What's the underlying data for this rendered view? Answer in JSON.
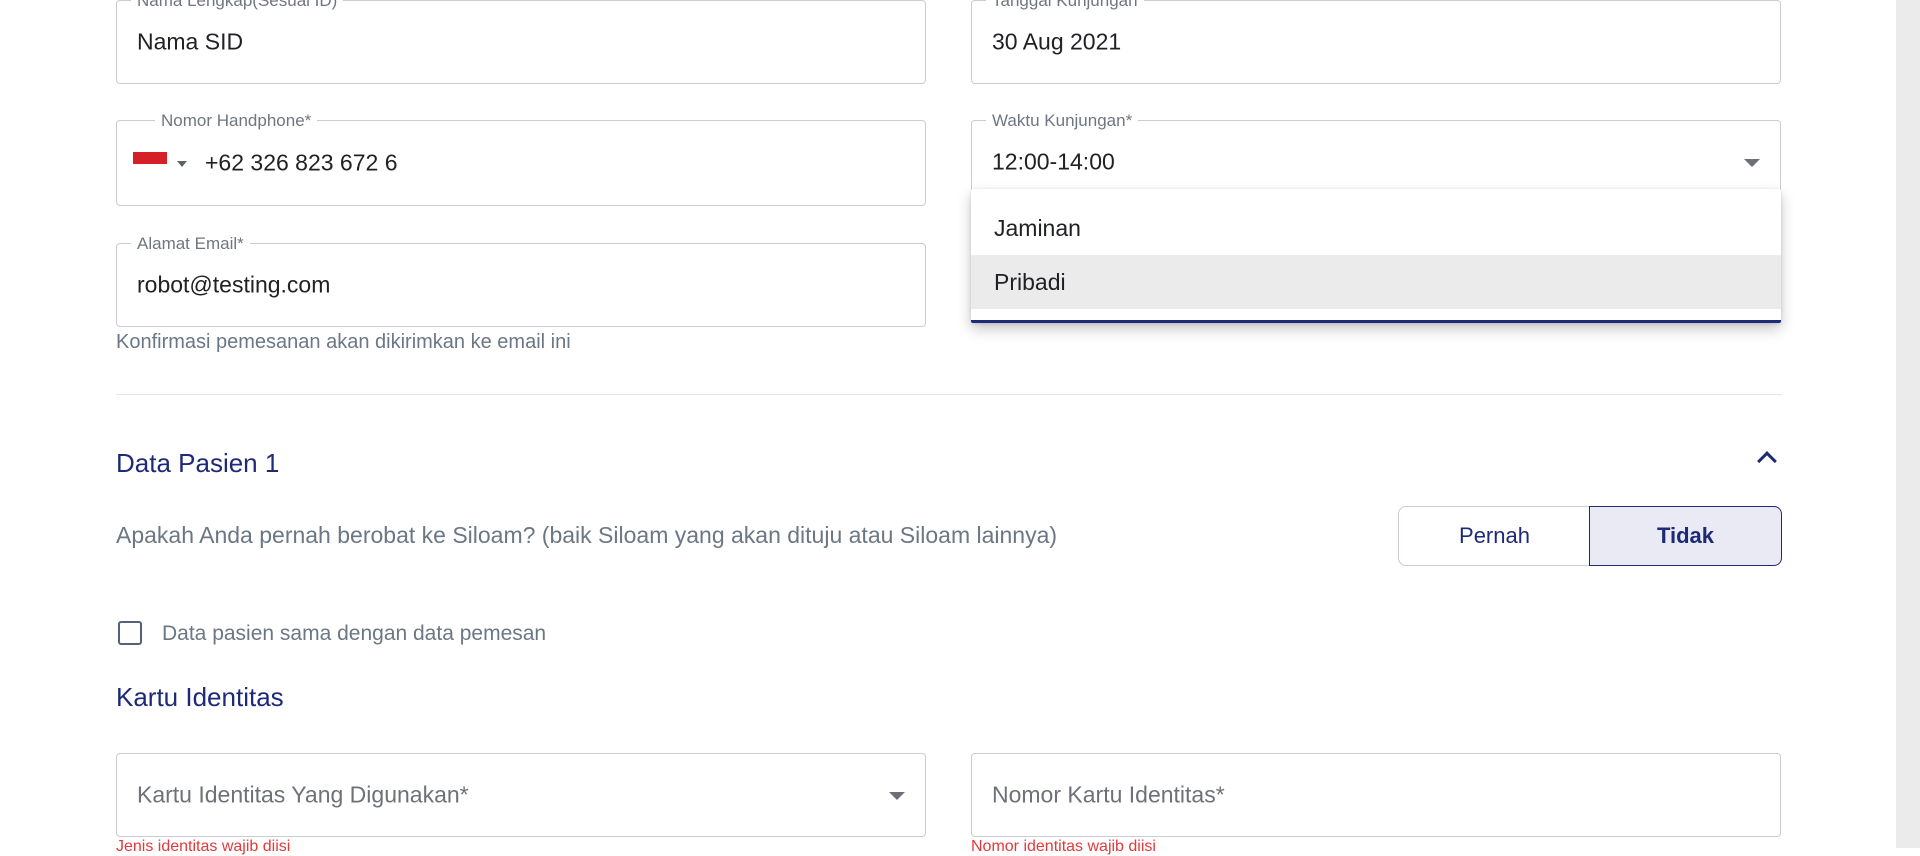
{
  "form": {
    "nama": {
      "label": "Nama Lengkap(Sesuai ID)",
      "value": "Nama SID"
    },
    "tanggal": {
      "label": "Tanggal Kunjungan",
      "value": "30 Aug 2021"
    },
    "phone": {
      "label": "Nomor Handphone*",
      "value": "+62 326 823 672 6",
      "country_flag": "flag-indonesia-icon"
    },
    "waktu": {
      "label": "Waktu Kunjungan*",
      "value": "12:00-14:00"
    },
    "email": {
      "label": "Alamat Email*",
      "value": "robot@testing.com",
      "helper": "Konfirmasi pemesanan akan dikirimkan ke email ini"
    },
    "payment_dropdown": {
      "options": [
        "Jaminan",
        "Pribadi"
      ],
      "highlighted": "Pribadi"
    }
  },
  "patient": {
    "section_title": "Data Pasien 1",
    "question": "Apakah Anda pernah berobat ke Siloam? (baik Siloam yang akan dituju atau Siloam lainnya)",
    "toggle": {
      "pernah": "Pernah",
      "tidak": "Tidak",
      "selected": "Tidak"
    },
    "same_data_checkbox": {
      "label": "Data pasien sama dengan data pemesan",
      "checked": false
    },
    "id_card": {
      "section_title": "Kartu Identitas",
      "type_placeholder": "Kartu Identitas Yang Digunakan*",
      "number_placeholder": "Nomor Kartu Identitas*",
      "type_error": "Jenis identitas wajib diisi",
      "number_error": "Nomor identitas wajib diisi"
    }
  },
  "colors": {
    "primary": "#1e2a78",
    "muted_text": "#6b7785",
    "error": "#e23a3a",
    "border": "#c9ccd3",
    "selected_bg": "#e9eaf4"
  }
}
